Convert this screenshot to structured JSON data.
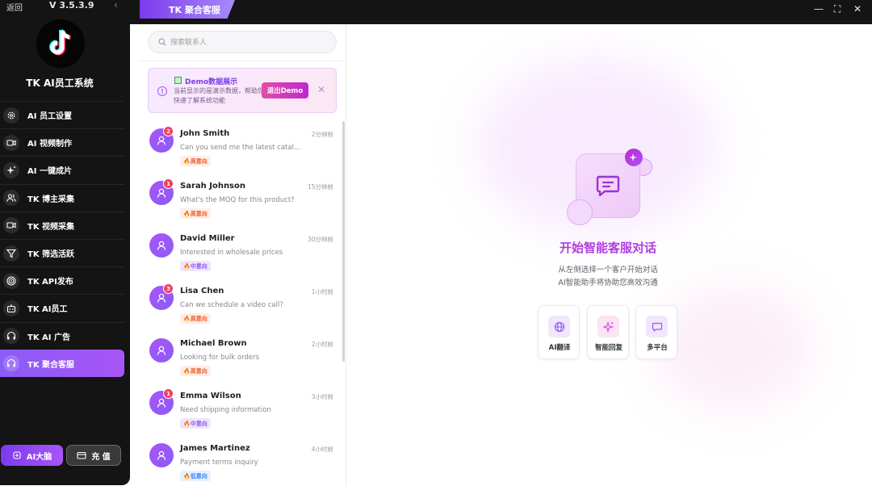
{
  "sidebar": {
    "back_label": "返回",
    "version": "V 3.5.3.9",
    "app_name": "TK AI员工系统",
    "items": [
      {
        "label": "AI 员工设置",
        "icon": "gear-icon"
      },
      {
        "label": "AI 视频制作",
        "icon": "video-camera-icon"
      },
      {
        "label": "AI 一键成片",
        "icon": "sparkles-icon"
      },
      {
        "label": "TK 博主采集",
        "icon": "users-icon"
      },
      {
        "label": "TK 视频采集",
        "icon": "video-camera-icon"
      },
      {
        "label": "TK 筛选活跃",
        "icon": "filter-icon"
      },
      {
        "label": "TK API发布",
        "icon": "target-icon"
      },
      {
        "label": "TK AI员工",
        "icon": "robot-icon"
      },
      {
        "label": "TK AI 广告",
        "icon": "headphones-icon"
      },
      {
        "label": "TK 聚合客服",
        "icon": "headset-icon",
        "active": true
      }
    ],
    "brain_button": "AI大脑",
    "recharge_button": "充 值"
  },
  "titlebar": {
    "tab_title": "TK 聚合客服"
  },
  "contacts": {
    "search_placeholder": "搜索联系人",
    "demo": {
      "title": "Demo数据展示",
      "description": "当前显示的是演示数据，帮助您快速了解系统功能",
      "exit_button": "退出Demo"
    },
    "items": [
      {
        "name": "John Smith",
        "time": "2分钟前",
        "message": "Can you send me the latest catal...",
        "intent": "高意向",
        "intent_level": "high",
        "unread": "2"
      },
      {
        "name": "Sarah Johnson",
        "time": "15分钟前",
        "message": "What's the MOQ for this product?",
        "intent": "高意向",
        "intent_level": "high",
        "unread": "1"
      },
      {
        "name": "David Miller",
        "time": "30分钟前",
        "message": "Interested in wholesale prices",
        "intent": "中意向",
        "intent_level": "mid",
        "unread": null
      },
      {
        "name": "Lisa Chen",
        "time": "1小时前",
        "message": "Can we schedule a video call?",
        "intent": "高意向",
        "intent_level": "high",
        "unread": "3"
      },
      {
        "name": "Michael Brown",
        "time": "2小时前",
        "message": "Looking for bulk orders",
        "intent": "高意向",
        "intent_level": "high",
        "unread": null
      },
      {
        "name": "Emma Wilson",
        "time": "3小时前",
        "message": "Need shipping information",
        "intent": "中意向",
        "intent_level": "mid",
        "unread": "1"
      },
      {
        "name": "James Martinez",
        "time": "4小时前",
        "message": "Payment terms inquiry",
        "intent": "低意向",
        "intent_level": "low",
        "unread": null
      }
    ]
  },
  "main": {
    "title": "开始智能客服对话",
    "subtitle_line1": "从左侧选择一个客户开始对话",
    "subtitle_line2": "AI智能助手将协助您高效沟通",
    "features": [
      {
        "label": "AI翻译",
        "icon": "globe-icon"
      },
      {
        "label": "智能回复",
        "icon": "sparkles-icon"
      },
      {
        "label": "多平台",
        "icon": "chat-bubble-icon"
      }
    ]
  },
  "colors": {
    "accent": "#8b5cf6",
    "accent_pink": "#c026d3",
    "sidebar_bg": "#141414",
    "high_intent": "#e8612c",
    "mid_intent": "#8b5cf6",
    "low_intent": "#3b82f6"
  }
}
